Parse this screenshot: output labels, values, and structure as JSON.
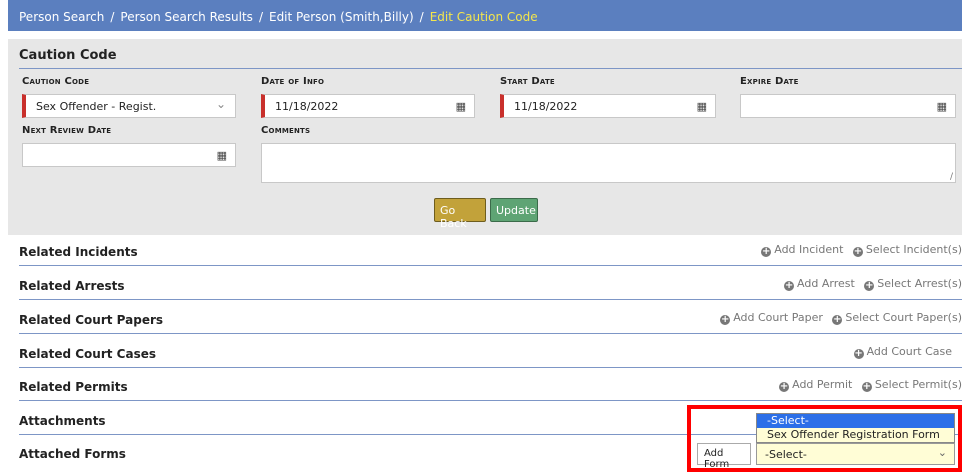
{
  "breadcrumb": {
    "items": [
      "Person Search",
      "Person Search Results",
      "Edit Person (Smith,Billy)"
    ],
    "current": "Edit Caution Code",
    "separator": "/"
  },
  "caution_panel": {
    "title": "Caution Code",
    "caution_code": {
      "label": "Caution Code",
      "value": "Sex Offender - Regist."
    },
    "date_of_info": {
      "label": "Date of Info",
      "value": "11/18/2022"
    },
    "start_date": {
      "label": "Start Date",
      "value": "11/18/2022"
    },
    "expire_date": {
      "label": "Expire Date",
      "value": ""
    },
    "next_review_date": {
      "label": "Next Review Date",
      "value": ""
    },
    "comments": {
      "label": "Comments",
      "value": ""
    },
    "go_back_label": "Go Back",
    "update_label": "Update"
  },
  "sections": {
    "incidents": {
      "title": "Related Incidents",
      "add": "Add Incident",
      "select": "Select Incident(s)"
    },
    "arrests": {
      "title": "Related Arrests",
      "add": "Add Arrest",
      "select": "Select Arrest(s)"
    },
    "court_papers": {
      "title": "Related Court Papers",
      "add": "Add Court Paper",
      "select": "Select Court Paper(s)"
    },
    "court_cases": {
      "title": "Related Court Cases",
      "add": "Add Court Case"
    },
    "permits": {
      "title": "Related Permits",
      "add": "Add Permit",
      "select": "Select Permit(s)"
    },
    "attachments": {
      "title": "Attachments"
    },
    "attached_forms": {
      "title": "Attached Forms",
      "add_form_label": "Add Form",
      "select_value": "-Select-",
      "options": [
        "-Select-",
        "Sex Offender Registration Form"
      ]
    }
  },
  "colors": {
    "breadcrumb_bg": "#5b7fbf",
    "breadcrumb_current": "#f4e64c",
    "required_marker": "#c9302c",
    "go_back_bg": "#c2a23a",
    "update_bg": "#5ea474",
    "highlight_border": "#ff0000",
    "dropdown_selected": "#2c6fe8"
  },
  "icons": {
    "calendar": "calendar-icon",
    "chevron": "chevron-down-icon",
    "add": "plus-circle-icon",
    "select": "plus-circle-icon"
  }
}
